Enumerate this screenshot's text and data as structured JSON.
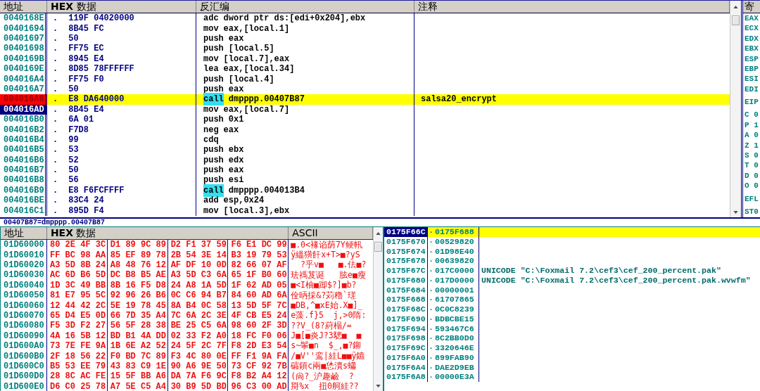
{
  "disassembly": {
    "columns": [
      "地址",
      "**HEX** 数据",
      "反汇编",
      "注释"
    ],
    "rows": [
      {
        "address": "0040168E",
        "marker": ".",
        "hex": "119F 04020000",
        "mnemonic": "adc",
        "operands": "dword ptr ds:[edi+0x204],ebx",
        "kind": "plain",
        "breakpoint": false,
        "current": false,
        "selected": false
      },
      {
        "address": "00401694",
        "marker": ".",
        "hex": "8B45 FC",
        "mnemonic": "mov",
        "operands": "eax,[local.1]",
        "kind": "plain",
        "breakpoint": false,
        "current": false,
        "selected": false
      },
      {
        "address": "00401697",
        "marker": ".",
        "hex": "50",
        "mnemonic": "push",
        "operands": "eax",
        "kind": "plain",
        "breakpoint": false,
        "current": false,
        "selected": false
      },
      {
        "address": "00401698",
        "marker": ".",
        "hex": "FF75 EC",
        "mnemonic": "push",
        "operands": "[local.5]",
        "kind": "plain",
        "breakpoint": false,
        "current": false,
        "selected": false
      },
      {
        "address": "0040169B",
        "marker": ".",
        "hex": "8945 E4",
        "mnemonic": "mov",
        "operands": "[local.7],eax",
        "kind": "plain",
        "breakpoint": false,
        "current": false,
        "selected": false
      },
      {
        "address": "0040169E",
        "marker": ".",
        "hex": "8D85 78FFFFFF",
        "mnemonic": "lea",
        "operands": "eax,[local.34]",
        "kind": "plain",
        "breakpoint": false,
        "current": false,
        "selected": false
      },
      {
        "address": "004016A4",
        "marker": ".",
        "hex": "FF75 F0",
        "mnemonic": "push",
        "operands": "[local.4]",
        "kind": "plain",
        "breakpoint": false,
        "current": false,
        "selected": false
      },
      {
        "address": "004016A7",
        "marker": ".",
        "hex": "50",
        "mnemonic": "push",
        "operands": "eax",
        "kind": "plain",
        "breakpoint": false,
        "current": false,
        "selected": false
      },
      {
        "address": "004016A8",
        "marker": ".",
        "hex": "E8 DA640000",
        "mnemonic": "call",
        "operands": "dmpppp.00407B87",
        "kind": "call",
        "comment": "salsa20_encrypt",
        "breakpoint": true,
        "current": true,
        "selected": false
      },
      {
        "address": "004016AD",
        "marker": ".",
        "hex": "8B45 E4",
        "mnemonic": "mov",
        "operands": "eax,[local.7]",
        "kind": "plain",
        "breakpoint": false,
        "current": false,
        "selected": true
      },
      {
        "address": "004016B0",
        "marker": ".",
        "hex": "6A 01",
        "mnemonic": "push",
        "operands": "0x1",
        "kind": "plain",
        "breakpoint": false,
        "current": false,
        "selected": false
      },
      {
        "address": "004016B2",
        "marker": ".",
        "hex": "F7D8",
        "mnemonic": "neg",
        "operands": "eax",
        "kind": "plain",
        "breakpoint": false,
        "current": false,
        "selected": false
      },
      {
        "address": "004016B4",
        "marker": ".",
        "hex": "99",
        "mnemonic": "cdq",
        "kind": "plain",
        "breakpoint": false,
        "current": false,
        "selected": false
      },
      {
        "address": "004016B5",
        "marker": ".",
        "hex": "53",
        "mnemonic": "push",
        "operands": "ebx",
        "kind": "plain",
        "breakpoint": false,
        "current": false,
        "selected": false
      },
      {
        "address": "004016B6",
        "marker": ".",
        "hex": "52",
        "mnemonic": "push",
        "operands": "edx",
        "kind": "plain",
        "breakpoint": false,
        "current": false,
        "selected": false
      },
      {
        "address": "004016B7",
        "marker": ".",
        "hex": "50",
        "mnemonic": "push",
        "operands": "eax",
        "kind": "plain",
        "breakpoint": false,
        "current": false,
        "selected": false
      },
      {
        "address": "004016B8",
        "marker": ".",
        "hex": "56",
        "mnemonic": "push",
        "operands": "esi",
        "kind": "plain",
        "breakpoint": false,
        "current": false,
        "selected": false
      },
      {
        "address": "004016B9",
        "marker": ".",
        "hex": "E8 F6FCFFFF",
        "mnemonic": "call",
        "operands": "dmpppp.004013B4",
        "kind": "call",
        "breakpoint": false,
        "current": false,
        "selected": false
      },
      {
        "address": "004016BE",
        "marker": ".",
        "hex": "83C4 24",
        "mnemonic": "add",
        "operands": "esp,0x24",
        "kind": "plain",
        "breakpoint": false,
        "current": false,
        "selected": false
      },
      {
        "address": "004016C1",
        "marker": ".",
        "hex": "895D F4",
        "mnemonic": "mov",
        "operands": "[local.3],ebx",
        "kind": "plain",
        "breakpoint": false,
        "current": false,
        "selected": false
      }
    ]
  },
  "registers": {
    "title": "寄",
    "groups": [
      [
        "EAX",
        "ECX",
        "EDX",
        "EBX",
        "ESP",
        "EBP",
        "ESI",
        "EDI"
      ],
      [
        "EIP"
      ],
      [
        "C 0",
        "P 1",
        "A 0",
        "Z 1",
        "S 0",
        "T 0",
        "D 0",
        "O 0"
      ],
      [
        "EFL"
      ],
      [
        "ST0"
      ]
    ]
  },
  "info_line": "00407B87=dmpppp.00407B87",
  "dump": {
    "columns": [
      "地址",
      "**HEX** 数据",
      "ASCII"
    ],
    "rows": [
      {
        "address": "01D60000",
        "groups": [
          "80 2E 4F 3C",
          "D1 89 9C 89",
          "D2 F1 37 59",
          "F6 E1 DC 99"
        ],
        "ascii": "■.0<褖谄荫7Y鲠軐",
        "changed": true
      },
      {
        "address": "01D60010",
        "groups": [
          "FF BC 98 AA",
          "85 EF 89 78",
          "2B 54 3E 14",
          "B3 19 79 53"
        ],
        "ascii": "ÿ縕獚飦x+T>■?yS",
        "changed": true
      },
      {
        "address": "01D60020",
        "groups": [
          "A3 5D 8B 24",
          "A8 48 76 12",
          "AF DF 10 0D",
          "82 66 07 AF"
        ],
        "ascii": "  ?乎v■   ■.佉■?",
        "changed": true
      },
      {
        "address": "01D60030",
        "groups": [
          "AC 6D B6 5D",
          "DC B8 B5 AE",
          "A3 5D C3 6A",
          "65 1F B0 60"
        ],
        "ascii": "珐禡芨诞   胘e■瘦",
        "changed": true
      },
      {
        "address": "01D60040",
        "groups": [
          "1D 3C 49 BB",
          "8B 16 F5 D8",
          "24 A8 1A 5D",
          "1F 62 AD 05"
        ],
        "ascii": "■<I柚■踋$?]■b?",
        "changed": true
      },
      {
        "address": "01D60050",
        "groups": [
          "81 E7 95 5C",
          "92 96 26 B6",
          "0C C6 94 B7",
          "84 60 AD 6A"
        ],
        "ascii": "佺昞採&?苅穭`瑳",
        "changed": true
      },
      {
        "address": "01D60060",
        "groups": [
          "12 44 42 2C",
          "5E 19 78 45",
          "8A B4 0C 58",
          "13 5D 5F 7C"
        ],
        "ascii": "■DB,^■xE始.X■]_",
        "changed": true
      },
      {
        "address": "01D60070",
        "groups": [
          "65 D4 E5 0D",
          "66 7D 35 A4",
          "7C 6A 2C 3E",
          "4F CB E5 24"
        ],
        "ascii": "e藻.f}5  j,>0隋:",
        "changed": true
      },
      {
        "address": "01D60080",
        "groups": [
          "F5 3D F2 27",
          "56 5F 28 38",
          "BE 25 C5 6A",
          "98 60 2F 3D"
        ],
        "ascii": "??V_(8?葤榻/=",
        "changed": true
      },
      {
        "address": "01D60090",
        "groups": [
          "4A 16 5B 12",
          "BD B1 4A DD",
          "02 33 F2 A0",
          "18 FC F0 06"
        ],
        "ascii": "J■[■炎J?3驄■  ■",
        "changed": true
      },
      {
        "address": "01D600A0",
        "groups": [
          "73 7E FE 9A",
          "1B 6E A2 52",
          "24 5F 2C 7F",
          "F8 2D E3 54"
        ],
        "ascii": "s~鬡■n  $_,■?鉚",
        "changed": true
      },
      {
        "address": "01D600B0",
        "groups": [
          "2F 18 56 22",
          "F0 BD 7C 89",
          "F3 4C 80 0E",
          "FF F1 9A FA"
        ],
        "ascii": "/■V''鸾|絓L■■ÿ鑣",
        "changed": true
      },
      {
        "address": "01D600C0",
        "groups": [
          "B5 53 EE 79",
          "43 83 C9 1E",
          "90 A6 9E 50",
          "73 CF 92 7B"
        ],
        "ascii": "礵顉c兩■恷瀆s蠨",
        "changed": true
      },
      {
        "address": "01D600D0",
        "groups": [
          "28 8C AC FE",
          "15 5F BB A6",
          "DA 7A F6 9C",
          "F8 B2 A4 12"
        ],
        "ascii": "(尙?_沪趣鹼  ?",
        "changed": true
      },
      {
        "address": "01D600E0",
        "groups": [
          "D6 C0 25 78",
          "A7 5E C5 A4",
          "30 B9 5D BD",
          "96 C3 00 AD"
        ],
        "ascii": "搿%x  扭0舸絓??",
        "changed": true
      }
    ]
  },
  "stack": {
    "rows": [
      {
        "address": "0175F66C",
        "marker": "·",
        "value": "0175F688",
        "selected": true,
        "current": true
      },
      {
        "address": "0175F670",
        "marker": "·",
        "value": "00529820",
        "selected": false,
        "current": false
      },
      {
        "address": "0175F674",
        "marker": "·",
        "value": "01D98E40",
        "selected": false,
        "current": false
      },
      {
        "address": "0175F678",
        "marker": "·",
        "value": "00639820",
        "selected": false,
        "current": false
      },
      {
        "address": "0175F67C",
        "marker": "·",
        "value": "017C0000",
        "comment": "UNICODE \"C:\\Foxmail 7.2\\cef3\\cef_200_percent.pak\"",
        "selected": false,
        "current": false
      },
      {
        "address": "0175F680",
        "marker": "·",
        "value": "017D0000",
        "comment": "UNICODE \"C:\\Foxmail 7.2\\cef3\\cef_200_percent.pak.wvwfm\"",
        "selected": false,
        "current": false
      },
      {
        "address": "0175F684",
        "marker": "·",
        "value": "00000001",
        "selected": false,
        "current": false
      },
      {
        "address": "0175F688",
        "marker": "·",
        "value": "61707865",
        "selected": false,
        "current": false
      },
      {
        "address": "0175F68C",
        "marker": "·",
        "value": "0C0C8239",
        "selected": false,
        "current": false
      },
      {
        "address": "0175F690",
        "marker": "·",
        "value": "BDBCBE15",
        "selected": false,
        "current": false
      },
      {
        "address": "0175F694",
        "marker": "·",
        "value": "593467C6",
        "selected": false,
        "current": false
      },
      {
        "address": "0175F698",
        "marker": "·",
        "value": "8C2BB0D0",
        "selected": false,
        "current": false
      },
      {
        "address": "0175F69C",
        "marker": "·",
        "value": "3320646E",
        "selected": false,
        "current": false
      },
      {
        "address": "0175F6A0",
        "marker": "·",
        "value": "899FAB90",
        "selected": false,
        "current": false
      },
      {
        "address": "0175F6A4",
        "marker": "·",
        "value": "DAE2D9EB",
        "selected": false,
        "current": false
      },
      {
        "address": "0175F6A8",
        "marker": "·",
        "value": "00000E3A",
        "selected": false,
        "current": false
      }
    ]
  }
}
